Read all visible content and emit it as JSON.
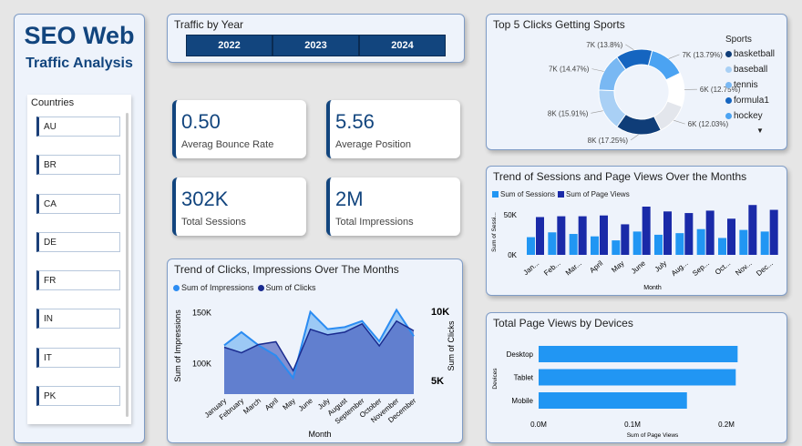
{
  "header": {
    "title": "SEO Web",
    "subtitle": "Traffic Analysis"
  },
  "countries": {
    "title": "Countries",
    "items": [
      "AU",
      "BR",
      "CA",
      "DE",
      "FR",
      "IN",
      "IT",
      "PK"
    ]
  },
  "year_filter": {
    "title": "Traffic by Year",
    "years": [
      "2022",
      "2023",
      "2024"
    ]
  },
  "kpis": {
    "bounce": {
      "value": "0.50",
      "label": "Averag Bounce Rate"
    },
    "position": {
      "value": "5.56",
      "label": "Average Position"
    },
    "sessions": {
      "value": "302K",
      "label": "Total Sessions"
    },
    "impressions": {
      "value": "2M",
      "label": "Total Impressions"
    }
  },
  "colors": {
    "navy": "#12457e",
    "impressions": "#2b8cf2",
    "clicks": "#1a2b8f",
    "sessions": "#2196f3",
    "pageviews": "#1a2aa8"
  },
  "chart_data": [
    {
      "id": "clicks",
      "type": "area",
      "title": "Trend of Clicks, Impressions Over The Months",
      "xlabel": "Month",
      "ylabel_left": "Sum of Impressions",
      "ylabel_right": "Sum of Clicks",
      "categories": [
        "January",
        "February",
        "March",
        "April",
        "May",
        "June",
        "July",
        "August",
        "September",
        "October",
        "November",
        "December"
      ],
      "series": [
        {
          "name": "Sum of Impressions",
          "axis": "left",
          "values": [
            118000,
            131000,
            118000,
            108000,
            86000,
            151000,
            134000,
            136000,
            142000,
            122000,
            153000,
            127000
          ]
        },
        {
          "name": "Sum of Clicks",
          "axis": "right",
          "values": [
            7400,
            7000,
            7600,
            7800,
            5700,
            8700,
            8300,
            8500,
            9100,
            7500,
            9300,
            8600
          ]
        }
      ],
      "ylim_left": [
        70000,
        165000
      ],
      "ylim_right": [
        4000,
        11000
      ],
      "yticks_left": [
        "150K",
        "100K"
      ],
      "yticks_right": [
        "10K",
        "5K"
      ]
    },
    {
      "id": "donut",
      "type": "pie",
      "title": "Top 5 Clicks Getting Sports",
      "legend_title": "Sports",
      "legend": [
        "basketball",
        "baseball",
        "tennis",
        "formula1",
        "hockey"
      ],
      "slices": [
        {
          "value": 13.79,
          "label": "7K (13.79%)",
          "color": "#4ba3f2"
        },
        {
          "value": 12.75,
          "label": "6K (12.75%)",
          "color": "#ffffff"
        },
        {
          "value": 12.03,
          "label": "6K (12.03%)",
          "color": "#e3e6ec"
        },
        {
          "value": 17.25,
          "label": "8K (17.25%)",
          "color": "#0f3d78"
        },
        {
          "value": 15.91,
          "label": "8K (15.91%)",
          "color": "#a9d0f5"
        },
        {
          "value": 14.47,
          "label": "7K (14.47%)",
          "color": "#79b8f3"
        },
        {
          "value": 13.8,
          "label": "7K (13.8%)",
          "color": "#1565c0"
        }
      ]
    },
    {
      "id": "sessions",
      "type": "bar",
      "title": "Trend of Sessions and Page Views Over the Months",
      "xlabel": "Month",
      "ylabel": "Sum of Sessi...",
      "categories": [
        "Jan...",
        "Feb...",
        "Mar...",
        "April",
        "May",
        "June",
        "July",
        "Aug...",
        "Sep...",
        "Oct...",
        "Nov...",
        "Dec..."
      ],
      "series": [
        {
          "name": "Sum of Sessions",
          "values": [
            22000,
            28000,
            26000,
            23000,
            18000,
            29000,
            25000,
            27000,
            32000,
            21000,
            31000,
            29000
          ]
        },
        {
          "name": "Sum of Page Views",
          "values": [
            47000,
            48000,
            48000,
            49000,
            38000,
            60000,
            54000,
            52000,
            55000,
            45000,
            62000,
            56000
          ]
        }
      ],
      "yticks": [
        "50K",
        "0K"
      ],
      "ylim": [
        0,
        60000
      ]
    },
    {
      "id": "devices",
      "type": "bar",
      "title": "Total Page Views by Devices",
      "xlabel": "Sum of Page Views",
      "ylabel": "Devices",
      "categories": [
        "Desktop",
        "Tablet",
        "Mobile"
      ],
      "values": [
        212000,
        210000,
        158000
      ],
      "xticks": [
        "0.0M",
        "0.1M",
        "0.2M"
      ],
      "xlim": [
        0,
        200000
      ]
    }
  ]
}
